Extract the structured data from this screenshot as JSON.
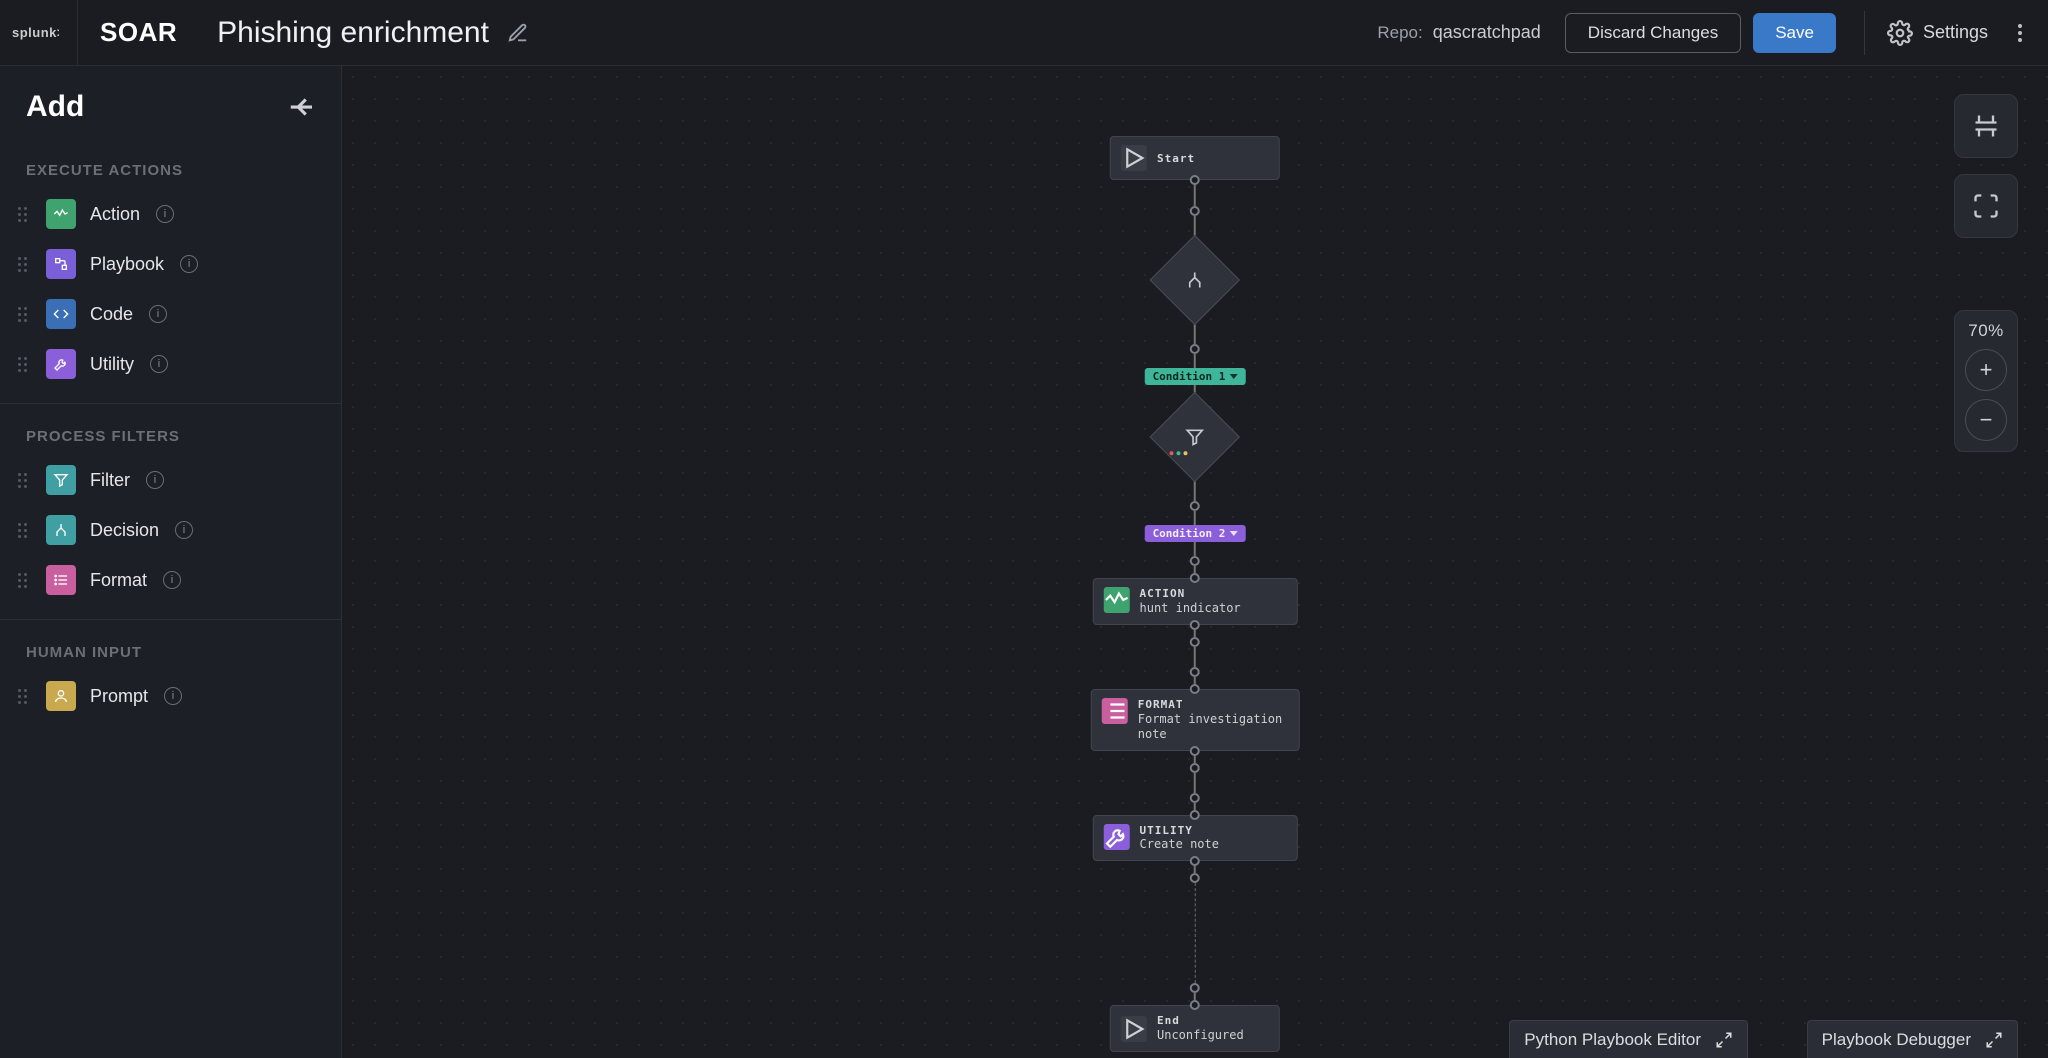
{
  "header": {
    "brand": "splunk>",
    "product": "SOAR",
    "title": "Phishing enrichment",
    "repo_label": "Repo:",
    "repo_value": "qascratchpad",
    "discard_label": "Discard Changes",
    "save_label": "Save",
    "settings_label": "Settings"
  },
  "sidebar": {
    "title": "Add",
    "sections": {
      "execute": {
        "label": "EXECUTE ACTIONS",
        "items": [
          {
            "label": "Action"
          },
          {
            "label": "Playbook"
          },
          {
            "label": "Code"
          },
          {
            "label": "Utility"
          }
        ]
      },
      "filters": {
        "label": "PROCESS FILTERS",
        "items": [
          {
            "label": "Filter"
          },
          {
            "label": "Decision"
          },
          {
            "label": "Format"
          }
        ]
      },
      "human": {
        "label": "HUMAN INPUT",
        "items": [
          {
            "label": "Prompt"
          }
        ]
      }
    }
  },
  "canvas": {
    "zoom": "70%",
    "bottom_editor": "Python Playbook Editor",
    "bottom_debugger": "Playbook Debugger"
  },
  "flow": {
    "start": {
      "label": "Start"
    },
    "condition1": {
      "label": "Condition 1"
    },
    "condition2": {
      "label": "Condition 2"
    },
    "action": {
      "kind": "ACTION",
      "detail": "hunt indicator"
    },
    "format": {
      "kind": "FORMAT",
      "detail1": "Format investigation",
      "detail2": "note"
    },
    "utility": {
      "kind": "UTILITY",
      "detail": "Create note"
    },
    "end": {
      "kind": "End",
      "detail": "Unconfigured"
    }
  }
}
